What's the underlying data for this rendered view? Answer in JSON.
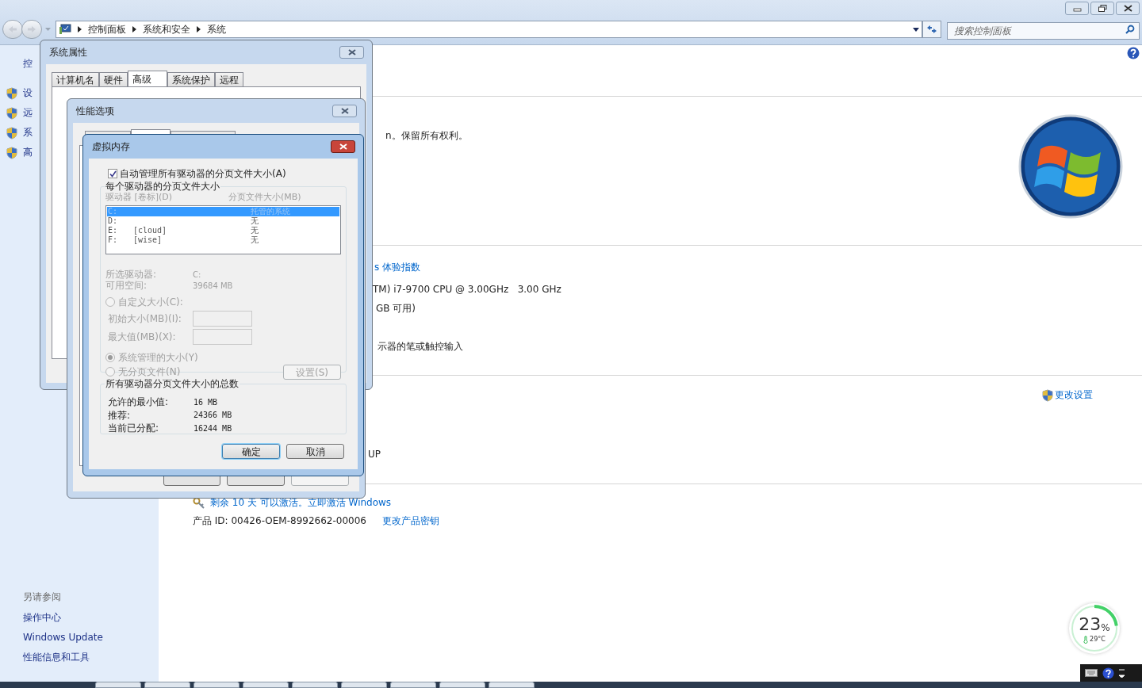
{
  "explorer": {
    "breadcrumb": [
      "控制面板",
      "系统和安全",
      "系统"
    ],
    "search": {
      "placeholder": "搜索控制面板"
    },
    "sidebar": {
      "top": "控",
      "items": [
        {
          "label": "设"
        },
        {
          "label": "远"
        },
        {
          "label": "系"
        },
        {
          "label": "高"
        }
      ],
      "see_also": {
        "title": "另请参阅",
        "links": [
          "操作中心",
          "Windows Update",
          "性能信息和工具"
        ]
      }
    },
    "content": {
      "copyright": "n。保留所有权利。",
      "rating_link": "s 体验指数",
      "processor": "TM) i7-9700 CPU @ 3.00GHz   3.00 GHz",
      "memory": "GB 可用)",
      "pen": "示器的笔或触控输入",
      "change_settings": "更改设置",
      "workgroup": "UP",
      "activation": "剩余 10 天 可以激活。立即激活 Windows",
      "product_id": "产品 ID: 00426-OEM-8992662-00006",
      "change_key": "更改产品密钥"
    }
  },
  "system_properties": {
    "title": "系统属性",
    "tabs": [
      {
        "label": "计算机名",
        "selected": false
      },
      {
        "label": "硬件",
        "selected": false
      },
      {
        "label": "高级",
        "selected": true
      },
      {
        "label": "系统保护",
        "selected": false
      },
      {
        "label": "远程",
        "selected": false
      }
    ]
  },
  "performance_options": {
    "title": "性能选项",
    "tabs": [
      {
        "selected": false
      },
      {
        "selected": true
      },
      {
        "selected": false
      }
    ]
  },
  "virtual_memory": {
    "title": "虚拟内存",
    "auto_manage": {
      "label": "自动管理所有驱动器的分页文件大小(A)",
      "checked": true
    },
    "per_drive": {
      "title": "每个驱动器的分页文件大小",
      "disabled": true,
      "columns": [
        "驱动器 [卷标](D)",
        "分页文件大小(MB)"
      ],
      "rows": [
        {
          "drive": "C:",
          "size": "托管的系统",
          "selected": true
        },
        {
          "drive": "D:",
          "size": "无",
          "selected": false
        },
        {
          "drive": "E:",
          "volume": "[cloud]",
          "size": "无",
          "selected": false
        },
        {
          "drive": "F:",
          "volume": "[wise]",
          "size": "无",
          "selected": false
        }
      ],
      "selected_drive": {
        "label": "所选驱动器:",
        "value": "C:"
      },
      "free_space": {
        "label": "可用空间:",
        "value": "39684 MB"
      },
      "options": [
        {
          "kind": "radio",
          "label": "自定义大小(C):",
          "selected": false
        },
        {
          "kind": "field",
          "label": "初始大小(MB)(I):"
        },
        {
          "kind": "field",
          "label": "最大值(MB)(X):"
        },
        {
          "kind": "radio",
          "label": "系统管理的大小(Y)",
          "selected": true
        },
        {
          "kind": "radio",
          "label": "无分页文件(N)",
          "selected": false
        }
      ],
      "set_button": "设置(S)"
    },
    "totals": {
      "title": "所有驱动器分页文件大小的总数",
      "rows": [
        {
          "label": "允许的最小值:",
          "value": "16 MB"
        },
        {
          "label": "推荐:",
          "value": "24366 MB"
        },
        {
          "label": "当前已分配:",
          "value": "16244 MB"
        }
      ]
    },
    "buttons": [
      {
        "label": "确定",
        "default": true
      },
      {
        "label": "取消",
        "default": false
      }
    ]
  },
  "widget": {
    "percent": "23",
    "unit": "%",
    "temperature": "29°C",
    "level": 0.23
  }
}
